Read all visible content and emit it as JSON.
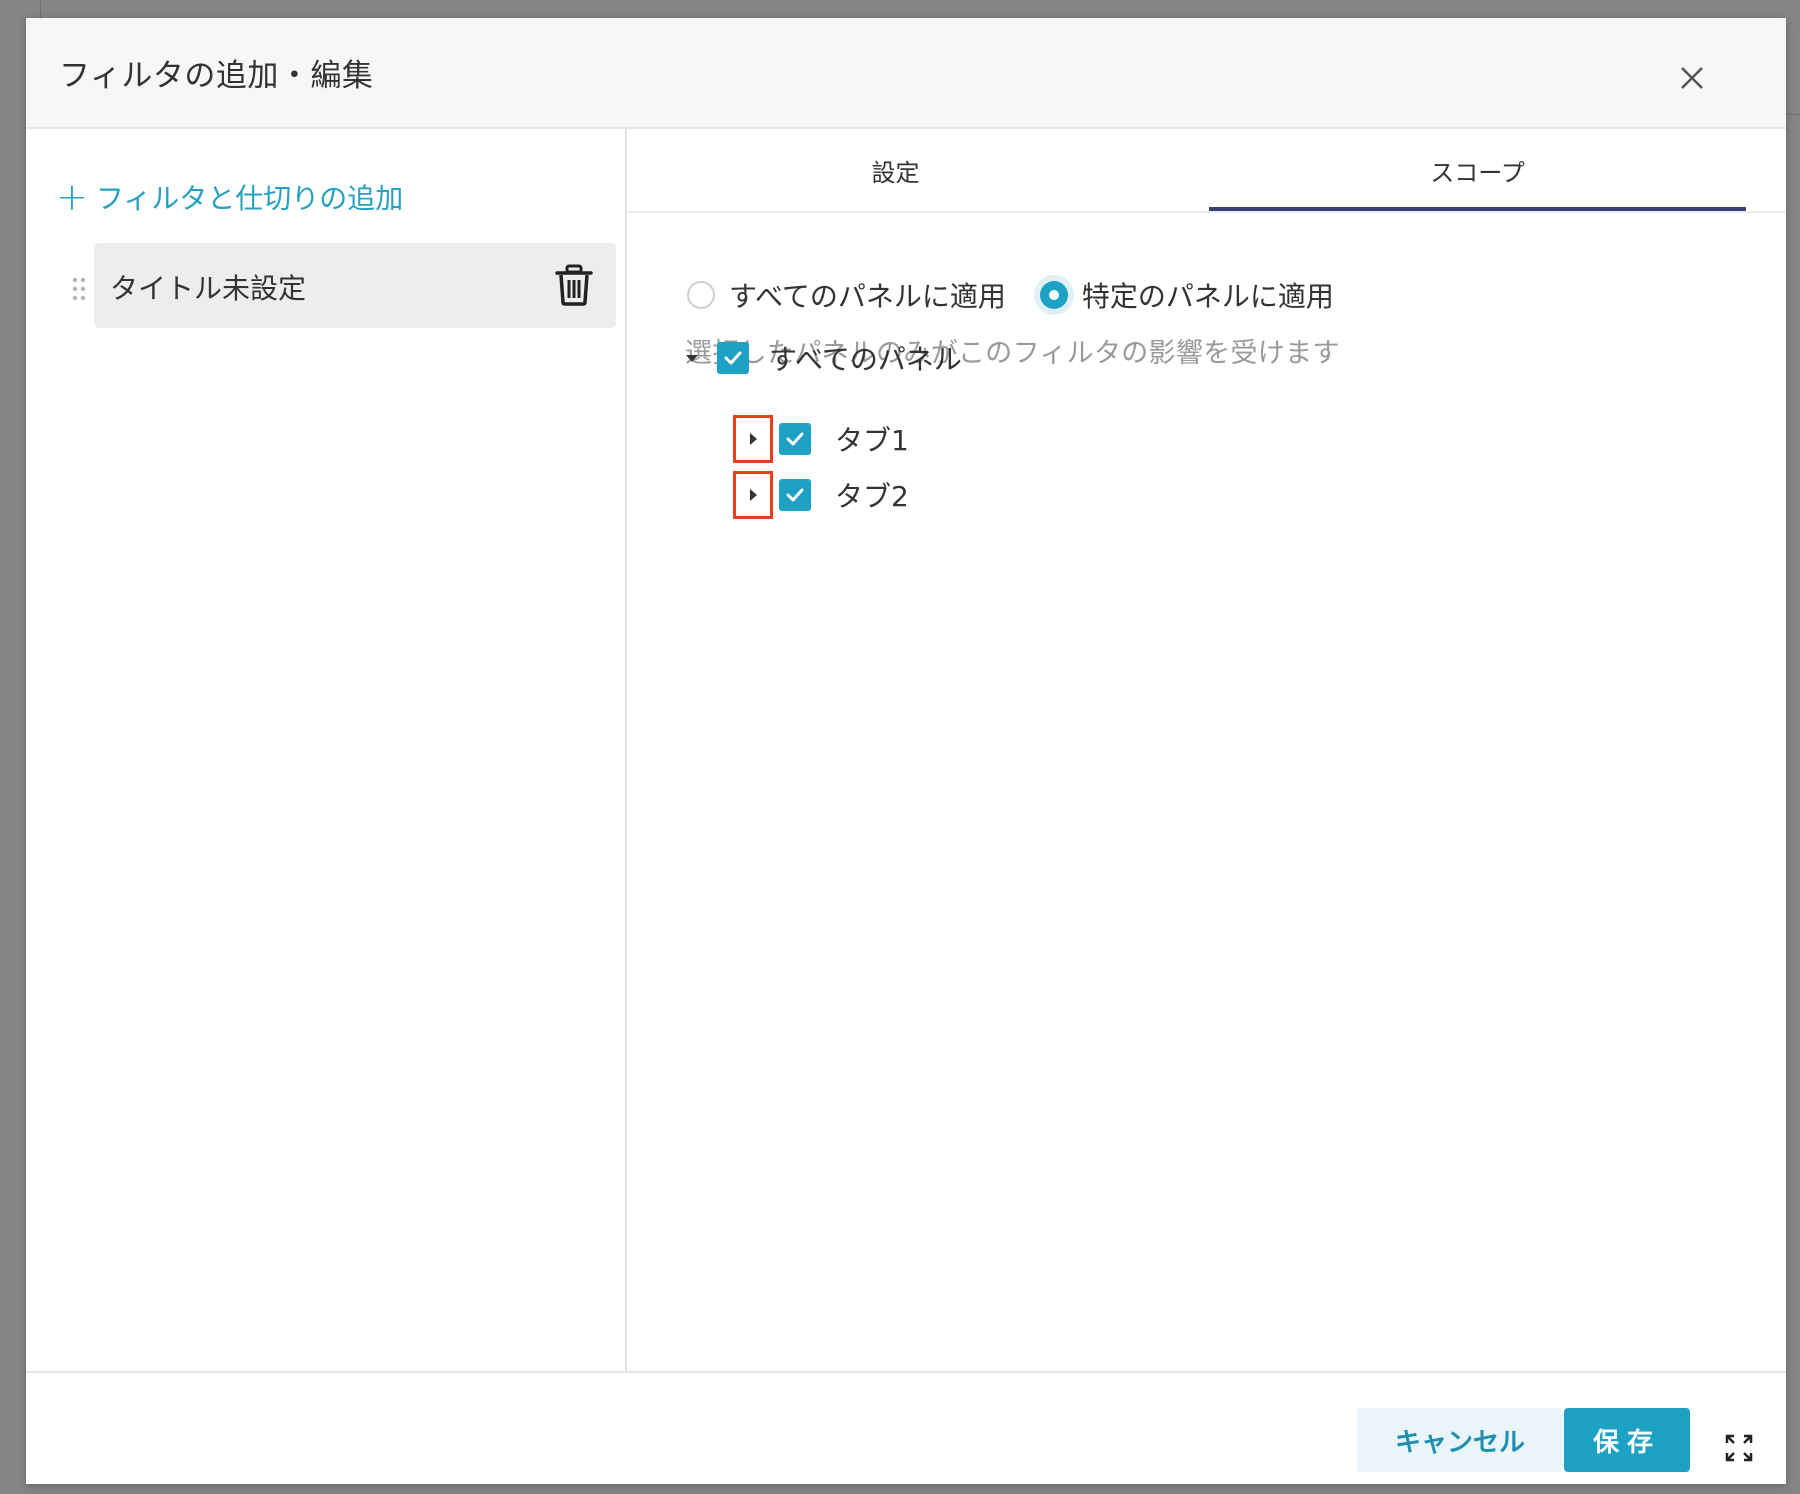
{
  "modal": {
    "title": "フィルタの追加・編集"
  },
  "sidebar": {
    "add_label": "フィルタと仕切りの追加",
    "items": [
      {
        "label": "タイトル未設定"
      }
    ]
  },
  "tabs": [
    {
      "label": "設定",
      "active": false
    },
    {
      "label": "スコープ",
      "active": true
    }
  ],
  "scope": {
    "radios": [
      {
        "label": "すべてのパネルに適用",
        "checked": false
      },
      {
        "label": "特定のパネルに適用",
        "checked": true
      }
    ],
    "hint": "選択したパネルのみがこのフィルタの影響を受けます",
    "tree": {
      "root": {
        "label": "すべてのパネル",
        "checked": true,
        "expanded": true
      },
      "children": [
        {
          "label": "タブ1",
          "checked": true,
          "expanded": false
        },
        {
          "label": "タブ2",
          "checked": true,
          "expanded": false
        }
      ]
    }
  },
  "footer": {
    "cancel_label": "キャンセル",
    "save_label": "保存"
  },
  "icons": {
    "close": "close-icon",
    "plus": "plus-icon",
    "drag": "drag-handle-icon",
    "trash": "trash-icon",
    "caret_down": "caret-down-icon",
    "caret_right": "caret-right-icon",
    "check": "check-icon",
    "expand": "expand-icon"
  },
  "colors": {
    "accent": "#1da1c4",
    "tab_indicator": "#3b3e70",
    "highlight_box": "#e8401c",
    "hint_text": "#9a9a9a"
  }
}
